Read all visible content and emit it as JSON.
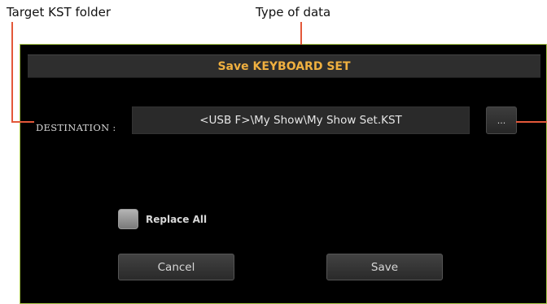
{
  "callouts": {
    "target_folder": "Target KST folder",
    "data_type": "Type of data"
  },
  "dialog": {
    "title": "Save KEYBOARD SET",
    "destination_label": "DESTINATION :",
    "destination_path": "<USB F>\\My Show\\My Show Set.KST",
    "browse_button": "...",
    "replace_all_label": "Replace All",
    "replace_all_checked": false,
    "cancel_button": "Cancel",
    "save_button": "Save"
  },
  "colors": {
    "title_text": "#f0b040",
    "frame_border": "#a8c84a",
    "callout_line": "#e3583a"
  }
}
